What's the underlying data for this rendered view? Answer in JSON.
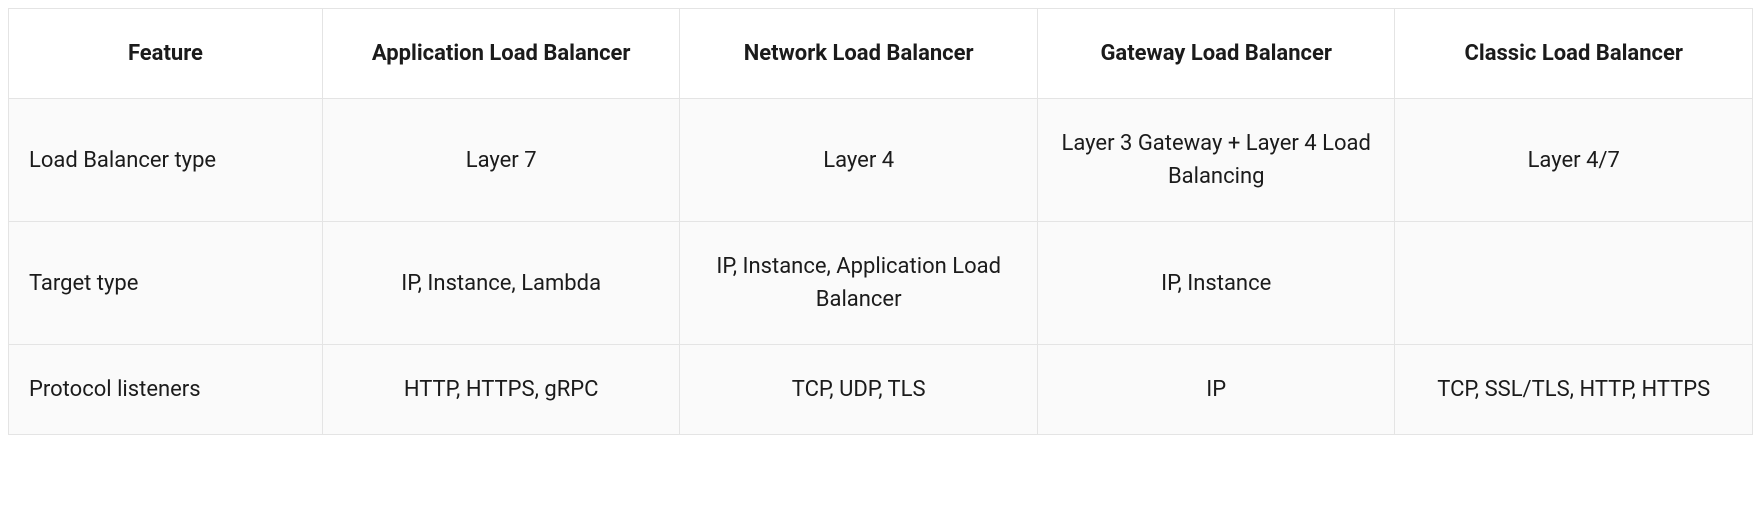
{
  "table": {
    "headers": [
      "Feature",
      "Application Load Balancer",
      "Network Load Balancer",
      "Gateway Load Balancer",
      "Classic Load Balancer"
    ],
    "rows": [
      {
        "feature": "Load Balancer type",
        "cells": [
          "Layer 7",
          "Layer 4",
          "Layer 3 Gateway + Layer 4 Load Balancing",
          "Layer 4/7"
        ]
      },
      {
        "feature": "Target type",
        "cells": [
          "IP, Instance, Lambda",
          "IP, Instance, Application Load Balancer",
          "IP, Instance",
          ""
        ]
      },
      {
        "feature": "Protocol listeners",
        "cells": [
          "HTTP, HTTPS, gRPC",
          "TCP, UDP, TLS",
          "IP",
          "TCP, SSL/TLS, HTTP, HTTPS"
        ]
      }
    ]
  }
}
